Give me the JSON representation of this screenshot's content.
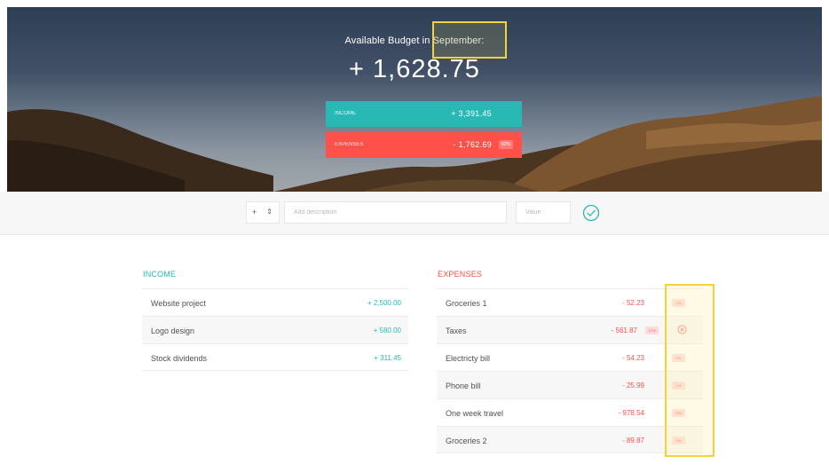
{
  "header": {
    "title": "Available Budget in September:",
    "budget": "+ 1,628.75",
    "income": {
      "label": "Income",
      "value": "+ 3,391.45"
    },
    "expenses": {
      "label": "Expenses",
      "value": "- 1,762.69",
      "percentage": "52%"
    }
  },
  "add_bar": {
    "type_value": "+",
    "description_placeholder": "Add description",
    "value_placeholder": "Value"
  },
  "income": {
    "title": "Income",
    "items": [
      {
        "description": "Website project",
        "value": "+ 2,500.00"
      },
      {
        "description": "Logo design",
        "value": "+ 580.00"
      },
      {
        "description": "Stock dividends",
        "value": "+ 311.45"
      }
    ]
  },
  "expenses": {
    "title": "Expenses",
    "items": [
      {
        "description": "Groceries 1",
        "value": "- 52.23",
        "percentage": "2%"
      },
      {
        "description": "Taxes",
        "value": "- 561.87",
        "percentage": "17%"
      },
      {
        "description": "Electricty bill",
        "value": "- 54.23",
        "percentage": "2%"
      },
      {
        "description": "Phone bill",
        "value": "- 25.99",
        "percentage": "1%"
      },
      {
        "description": "One week travel",
        "value": "- 978.54",
        "percentage": "29%"
      },
      {
        "description": "Groceries 2",
        "value": "- 89.87",
        "percentage": "3%"
      }
    ]
  },
  "colors": {
    "income": "#28b9b5",
    "expenses": "#ff5049",
    "highlight": "#f4d23a"
  }
}
